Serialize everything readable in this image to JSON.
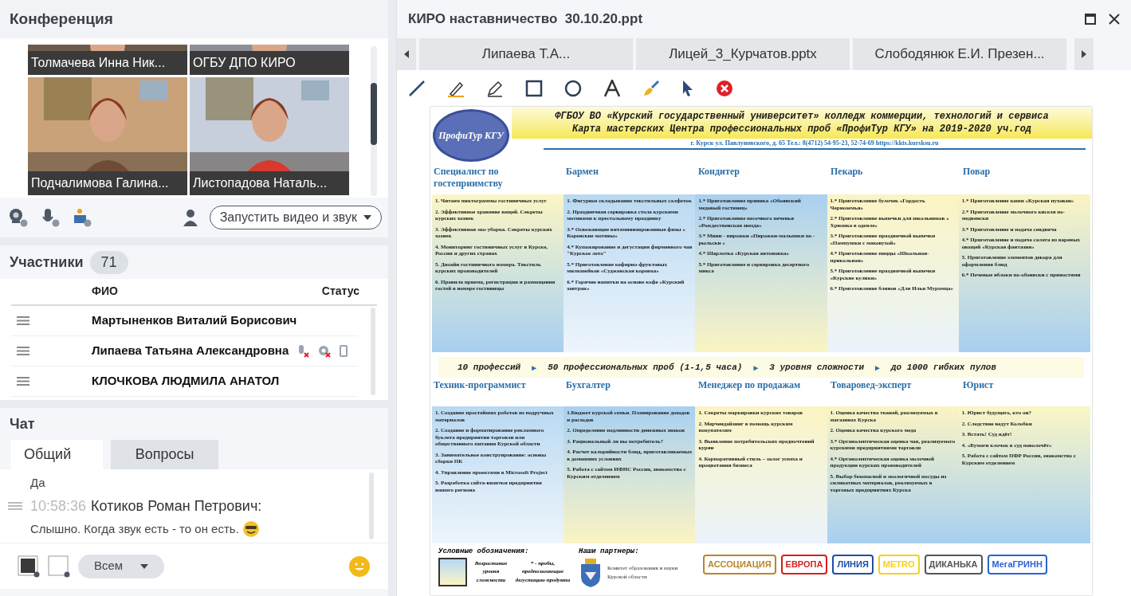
{
  "conference": {
    "title": "Конференция",
    "videos": [
      {
        "name": "Толмачева Инна  Ник..."
      },
      {
        "name": "ОГБУ ДПО КИРО"
      },
      {
        "name": "Подчалимова  Галина..."
      },
      {
        "name": "Листопадова Наталь..."
      }
    ],
    "start_button": "Запустить видео и звук"
  },
  "participants": {
    "title": "Участники",
    "count": "71",
    "columns": [
      "ФИО",
      "Статус"
    ],
    "rows": [
      {
        "name": "Мартыненков Виталий  Борисович",
        "kind": "plain"
      },
      {
        "name": "Липаева Татьяна  Александровна",
        "kind": "with-status"
      },
      {
        "name": "КЛОЧКОВА ЛЮДМИЛА  АНАТОЛ",
        "kind": "plain"
      }
    ]
  },
  "chat": {
    "title": "Чат",
    "tabs": [
      {
        "label": "Общий",
        "selected": true
      },
      {
        "label": "Вопросы",
        "selected": false
      }
    ],
    "messages": [
      {
        "kind": "text",
        "text": "Да",
        "emoji": false
      },
      {
        "kind": "header",
        "time": "10:58:36",
        "author": "Котиков Роман Петрович:"
      },
      {
        "kind": "text",
        "text": "Слышно. Когда звук есть - то он есть.",
        "emoji": true
      }
    ],
    "recipient": "Всем"
  },
  "presentation": {
    "title": "КИРО наставничество  30.10.20.ppt",
    "tabs": [
      "Липаева Т.А...",
      "Лицей_3_Курчатов.pptx",
      "Слободянюк Е.И. Презен..."
    ],
    "slide": {
      "logo": "ПрофиТур КГУ",
      "header": [
        "ФГБОУ ВО «Курский государственный университет» колледж коммерции, технологий и сервиса",
        "Карта мастерских Центра профессиональных проб «ПрофиТур КГУ» на 2019-2020 уч.год"
      ],
      "address": "г. Курск ул. Павлуновского, д. 65 Тел.: 8(4712) 54-95-23, 52-74-69 https://kkts.kursksu.ru",
      "rows": [
        {
          "columns": [
            {
              "title": "Специалист по гостеприимству",
              "items": [
                "1. Читаем пиктограммы гостиничных услуг",
                "2. Эффективное хранение вещей. Секреты курских хозяек",
                "3. Эффективная эко-уборка. Секреты курских хозяек",
                "4. Мониторинг гостиничных услуг в Курске, России и других странах",
                "5. Дизайн гостиничного номера. Текстиль курских производителей",
                "6. Правила приема, регистрации и размещения гостей в номере гостиницы"
              ]
            },
            {
              "title": "Бармен",
              "items": [
                "1. Фигурное складывание текстильных салфеток",
                "2. Праздничная сервировка стола курскими мотивами к престольному празднику",
                "3.* Освежающие витаминизированные физы « Коренские мотивы»",
                "4.* Купажирование и дегустация фирменного чая \"Курское лето\"",
                "5.* Приготовление кефирно-фруктовых милкшейков «Суджанская коровка»",
                "6.* Горячие напитки на основе кофе «Курский завтрак»"
              ]
            },
            {
              "title": "Кондитер",
              "items": [
                "1.* Приготовление пряника «Обоянский медовый гостинец»",
                "2.* Приготовление песочного печенья «Рождественская звезда»",
                "3.* Мини - пирожки «Пирожки-малышки по - рыльски »",
                "4.* Шарлотка «Курская антоновка»",
                "5.* Приготовление и сервировка десертного микса"
              ]
            },
            {
              "title": "Пекарь",
              "items": [
                "1.* Приготовление булочек «Гордость Черноземья»",
                "2.* Приготовление выпечки для школьников « Хрюшка в одеяле»",
                "3.* Приготовление праздничной выпечки «Пампушки с маковухой»",
                "4.* Приготовление пиццы «Школьная-прикольная»",
                "5.* Приготовление праздничной выпечки «Курские кулики»",
                "6.* Приготовление блинов «Для Ильи Муромца»"
              ]
            },
            {
              "title": "Повар",
              "items": [
                "1.* Приготовление каши «Курская пухован»",
                "2.* Приготовление молочного киселя по-медвенски",
                "3.* Приготовление и подача сендвича",
                "4.* Приготовление и подача салата из вареных овощей «Курская фантазия»",
                "5. Приготовление элементов декора для оформления блюд",
                "6.* Печеные яблоки по-обоянски с пряностями"
              ]
            }
          ]
        },
        {
          "columns": [
            {
              "title": "Техник-программист",
              "items": [
                "1. Создание простейших роботов из подручных материалов",
                "2. Создание и форматирование рекламного буклета предприятия торговли или общественного питания Курской области",
                "3. Занимательное конструирование: основы сборки ПК",
                "4. Управление проектами в Microsoft Project",
                "5. Разработка сайта-визитки предприятия нашего региона"
              ]
            },
            {
              "title": "Бухгалтер",
              "items": [
                "1.Бюджет курской семьи. Планирование доходов и расходов",
                "2. Определение подлинности денежных знаков",
                "3. Рациональный ли вы потребитель?",
                "4. Расчет калорийности блюд, приготавливаемых в домашних условиях",
                "5. Работа с сайтом ИФНС России, знакомство с Курским отделением"
              ]
            },
            {
              "title": "Менеджер по продажам",
              "items": [
                "1. Секреты маркировки курских товаров",
                "2. Мерчендайзинг в помощь курским покупателям",
                "3. Выявление потребительских предпочтений курян",
                "4. Корпоративный стиль – залог успеха и процветания бизнеса"
              ]
            },
            {
              "title": "Товаровед-эксперт",
              "items": [
                "1. Оценка качества тканей, реализуемых в магазинах Курска",
                "2. Оценка качества курского меда",
                "3.* Органолептическая оценка чая, реализуемого курскими предприятиями торговли",
                "4.* Органолептическая оценка молочной продукции курских производителей",
                "5. Выбор безопасной и экологичной посуды из силикатных материалов, реализуемых в торговых предприятиях Курска"
              ]
            },
            {
              "title": "Юрист",
              "items": [
                "1. Юрист будущего, кто он?",
                "2. Следствие ведут Колобки",
                "3. Встать! Суд идёт!",
                "4. «Бумаги клочок в суд поволочёт»",
                "5. Работа с сайтом ПФР России, знакомство с Курским отделением"
              ]
            }
          ]
        }
      ],
      "strip": [
        {
          "text": "10 профессий"
        },
        {
          "marker": "►",
          "text": "50 профессиональных проб (1-1,5 часа)"
        },
        {
          "marker": "►",
          "text": "3 уровня сложности"
        },
        {
          "marker": "►",
          "text": "до 1000 гибких пулов"
        }
      ],
      "legend": {
        "title": "Условные обозначения:",
        "gradient_label": "Возрастание уровня сложности",
        "star_note": "* - пробы, предполагающие дегустацию продукта"
      },
      "partners": {
        "title": "Наши партнеры:",
        "committee": "Комитет образования и науки Курской области",
        "logos": [
          {
            "text": "АССОЦИАЦИЯ",
            "color": "#b8862e"
          },
          {
            "text": "ЕВРОПА",
            "color": "#d81e1e"
          },
          {
            "text": "ЛИНИЯ",
            "color": "#1c4fa8"
          },
          {
            "text": "METRO",
            "color": "#f3d21b"
          },
          {
            "text": "ДИКАНЬКА",
            "color": "#555555"
          },
          {
            "text": "МегаГРИНН",
            "color": "#2a62d6"
          }
        ]
      }
    }
  }
}
